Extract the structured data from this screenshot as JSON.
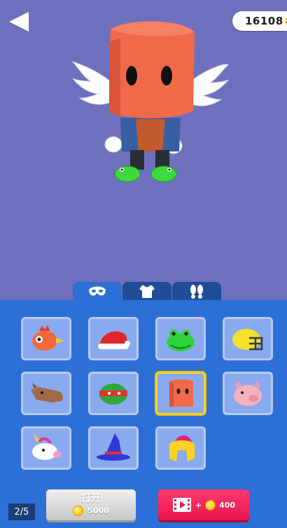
{
  "header": {
    "coin_balance": "16108",
    "back_icon": "back-arrow-icon",
    "coin_icon": "gold-coin-icon"
  },
  "tabs": [
    {
      "name": "hats",
      "icon": "mask-icon",
      "active": true
    },
    {
      "name": "outfits",
      "icon": "shirt-icon",
      "active": false
    },
    {
      "name": "shoes",
      "icon": "footprints-icon",
      "active": false
    }
  ],
  "items": [
    {
      "name": "chicken-head",
      "selected": false
    },
    {
      "name": "santa-hat",
      "selected": false
    },
    {
      "name": "frog-head",
      "selected": false
    },
    {
      "name": "football-helmet",
      "selected": false
    },
    {
      "name": "horse-head",
      "selected": false
    },
    {
      "name": "ninja-turtle-head",
      "selected": false
    },
    {
      "name": "orange-box-head",
      "selected": true
    },
    {
      "name": "pig-head",
      "selected": false
    },
    {
      "name": "unicorn-head",
      "selected": false
    },
    {
      "name": "wizard-hat",
      "selected": false
    },
    {
      "name": "spartan-helmet",
      "selected": false
    }
  ],
  "pagination": {
    "text": "2/5"
  },
  "open_button": {
    "label": "打开",
    "price": "5000"
  },
  "video_button": {
    "plus": "+",
    "amount": "400",
    "icon": "video-film-icon"
  },
  "colors": {
    "background": "#6f70bd",
    "panel": "#2c6fd6",
    "tab_inactive": "#1f4d97",
    "selected_border": "#ffd21f",
    "video_button": "#ff3a6e"
  }
}
